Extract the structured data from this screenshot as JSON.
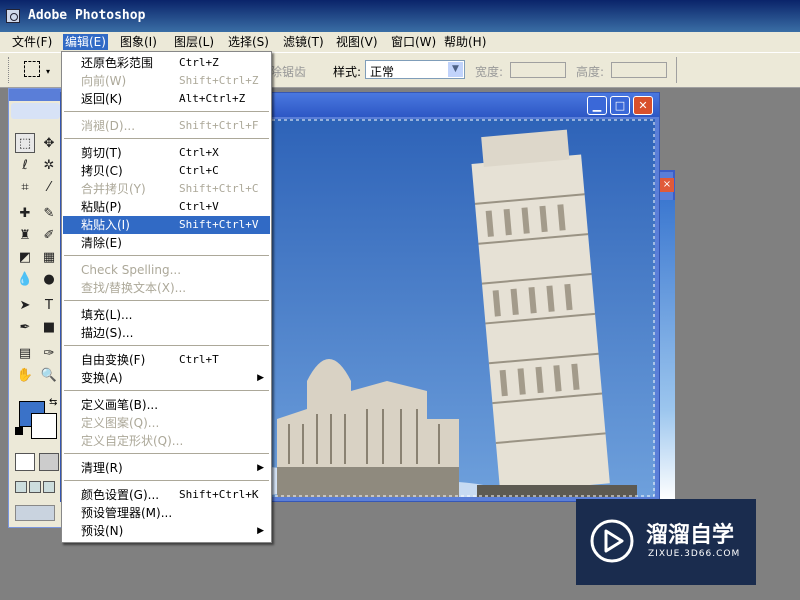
{
  "app": {
    "title": "Adobe Photoshop"
  },
  "menubar": {
    "items": [
      "文件(F)",
      "编辑(E)",
      "图象(I)",
      "图层(L)",
      "选择(S)",
      "滤镜(T)",
      "视图(V)",
      "窗口(W)",
      "帮助(H)"
    ],
    "active": "编辑(E)"
  },
  "options": {
    "antialias_label": "消除锯齿",
    "style_label": "样式:",
    "style_value": "正常",
    "width_label": "宽度:",
    "height_label": "高度:"
  },
  "edit_menu": {
    "items": [
      {
        "label": "还原色彩范围",
        "shortcut": "Ctrl+Z",
        "disabled": false
      },
      {
        "label": "向前(W)",
        "shortcut": "Shift+Ctrl+Z",
        "disabled": true
      },
      {
        "label": "返回(K)",
        "shortcut": "Alt+Ctrl+Z",
        "disabled": false
      },
      {
        "label": "消褪(D)...",
        "shortcut": "Shift+Ctrl+F",
        "disabled": true
      },
      {
        "label": "剪切(T)",
        "shortcut": "Ctrl+X",
        "disabled": false
      },
      {
        "label": "拷贝(C)",
        "shortcut": "Ctrl+C",
        "disabled": false
      },
      {
        "label": "合并拷贝(Y)",
        "shortcut": "Shift+Ctrl+C",
        "disabled": true
      },
      {
        "label": "粘贴(P)",
        "shortcut": "Ctrl+V",
        "disabled": false
      },
      {
        "label": "粘贴入(I)",
        "shortcut": "Shift+Ctrl+V",
        "disabled": false,
        "highlighted": true
      },
      {
        "label": "清除(E)",
        "shortcut": "",
        "disabled": false
      },
      {
        "label": "Check Spelling...",
        "shortcut": "",
        "disabled": true
      },
      {
        "label": "查找/替换文本(X)...",
        "shortcut": "",
        "disabled": true
      },
      {
        "label": "填充(L)...",
        "shortcut": "",
        "disabled": false
      },
      {
        "label": "描边(S)...",
        "shortcut": "",
        "disabled": false
      },
      {
        "label": "自由变换(F)",
        "shortcut": "Ctrl+T",
        "disabled": false
      },
      {
        "label": "变换(A)",
        "shortcut": "",
        "disabled": false,
        "submenu": true
      },
      {
        "label": "定义画笔(B)...",
        "shortcut": "",
        "disabled": false
      },
      {
        "label": "定义图案(Q)...",
        "shortcut": "",
        "disabled": true
      },
      {
        "label": "定义自定形状(Q)...",
        "shortcut": "",
        "disabled": true
      },
      {
        "label": "清理(R)",
        "shortcut": "",
        "disabled": false,
        "submenu": true
      },
      {
        "label": "颜色设置(G)...",
        "shortcut": "Shift+Ctrl+K",
        "disabled": false
      },
      {
        "label": "预设管理器(M)...",
        "shortcut": "",
        "disabled": false
      },
      {
        "label": "预设(N)",
        "shortcut": "",
        "disabled": false,
        "submenu": true
      }
    ]
  },
  "colors": {
    "foreground": "#3a72c8",
    "background": "#ffffff",
    "highlight": "#316ac5",
    "disabled": "#aca899"
  },
  "watermark": {
    "brand": "溜溜自学",
    "url": "ZIXUE.3D66.COM"
  }
}
